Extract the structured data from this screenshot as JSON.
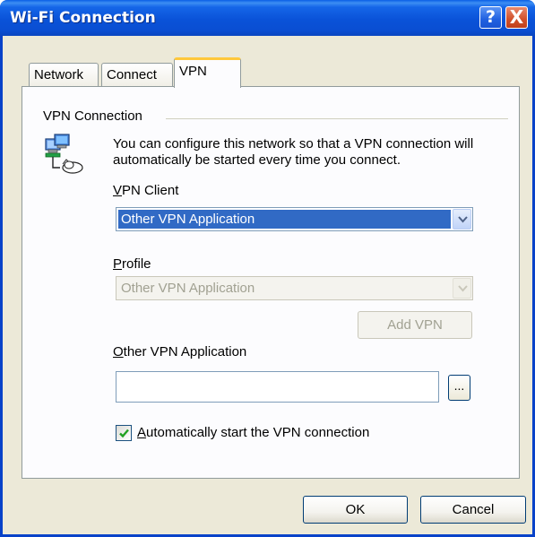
{
  "window": {
    "title": "Wi-Fi Connection",
    "help_glyph": "?",
    "close_glyph": "X"
  },
  "tabs": [
    {
      "label": "Network",
      "active": false
    },
    {
      "label": "Connect",
      "active": false
    },
    {
      "label": "VPN",
      "active": true
    }
  ],
  "vpn_group": {
    "label": "VPN Connection",
    "icon": "network-computers-icon",
    "description": "You can configure this network so that a VPN connection will automatically be started every time you connect."
  },
  "vpn_client": {
    "label_accel": "V",
    "label_rest": "PN Client",
    "selected": "Other VPN Application"
  },
  "profile": {
    "label_accel": "P",
    "label_rest": "rofile",
    "selected": "Other VPN Application",
    "enabled": false
  },
  "add_vpn_label": "Add VPN",
  "other_app": {
    "label_accel": "O",
    "label_rest": "ther VPN Application",
    "value": "",
    "browse_label": "..."
  },
  "auto_start": {
    "label_accel": "A",
    "label_rest": "utomatically start the VPN connection",
    "checked": true
  },
  "footer": {
    "ok_label": "OK",
    "cancel_label": "Cancel"
  },
  "colors": {
    "titlebar": "#0a52d8",
    "selection": "#316ac5",
    "active_tab_accent": "#ffc83c",
    "dialog_bg": "#ece9d8",
    "check_mark": "#21a121"
  }
}
